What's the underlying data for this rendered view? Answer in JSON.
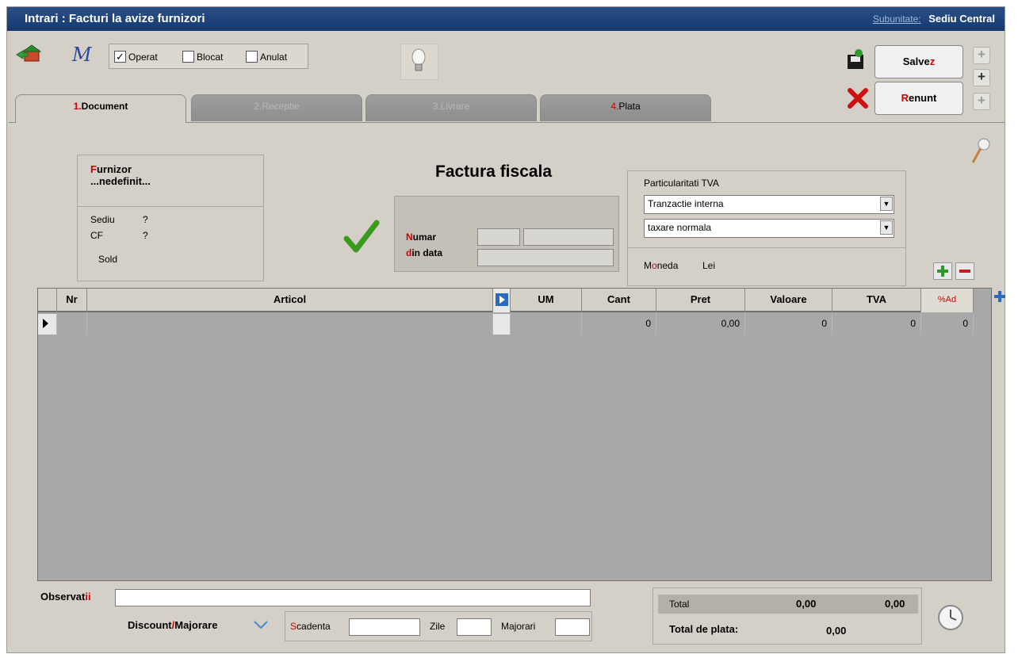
{
  "window": {
    "title": "Intrari : Facturi la avize furnizori",
    "subunit_label": "Subunitate:",
    "subunit_value": "Sediu Central"
  },
  "toolbar": {
    "checkboxes": [
      {
        "label": "Operat",
        "checked": true
      },
      {
        "label": "Blocat",
        "checked": false
      },
      {
        "label": "Anulat",
        "checked": false
      }
    ],
    "save_label": "Salve",
    "save_hot": "z",
    "cancel_hot": "R",
    "cancel_label": "enunt"
  },
  "tabs": [
    {
      "num": "1.",
      "label": "Document",
      "state": "active"
    },
    {
      "num": "2.",
      "label": "Receptie",
      "state": "disabled"
    },
    {
      "num": "3.",
      "label": "Livrare",
      "state": "disabled"
    },
    {
      "num": "4.",
      "label": "Plata",
      "state": "enabled"
    }
  ],
  "supplier": {
    "label_hot": "F",
    "label": "urnizor",
    "value": "...nedefinit...",
    "sediu_label": "Sediu",
    "sediu_value": "?",
    "cf_label": "CF",
    "cf_value": "?",
    "sold_label": "Sold"
  },
  "document": {
    "heading": "Factura fiscala",
    "numar_hot": "N",
    "numar_label": "umar",
    "data_hot": "d",
    "data_label": "in data"
  },
  "vat": {
    "label": "Particularitati TVA",
    "transaction": "Tranzactie interna",
    "taxation": "taxare normala",
    "currency_label_pre": "M",
    "currency_label_hot": "o",
    "currency_label_post": "neda",
    "currency_value": "Lei"
  },
  "grid": {
    "columns": [
      "Nr",
      "Articol",
      "",
      "UM",
      "Cant",
      "Pret",
      "Valoare",
      "TVA",
      "%Ad"
    ],
    "rows": [
      {
        "nr": "",
        "articol": "",
        "um": "",
        "cant": "0",
        "pret": "0,00",
        "valoare": "0",
        "tva": "0",
        "ad": "0"
      }
    ]
  },
  "footer": {
    "obs_label": "Observat",
    "obs_hot": "ii",
    "discount_label": "Discount",
    "discount_sep": "/",
    "majorare_label": "Majorare",
    "scadenta_hot": "S",
    "scadenta_label": "cadenta",
    "zile_label": "Zile",
    "majorari_label": "Majorari",
    "total_label": "Total",
    "total_value1": "0,00",
    "total_value2": "0,00",
    "total_plata_label": "Total de plata:",
    "total_plata_value": "0,00"
  },
  "colors": {
    "title_bg": "#1f477f",
    "window_bg": "#d4d0c8",
    "grid_bg": "#a8a8a8",
    "hotkey": "#d00000"
  },
  "icons": [
    "export-icon",
    "macro-icon",
    "bulb-icon",
    "save-disk-icon",
    "cancel-x-icon",
    "checkmark-icon",
    "add-icon",
    "remove-icon",
    "pin-icon",
    "clock-icon",
    "row-pointer-icon",
    "dropdown-arrow-icon"
  ]
}
